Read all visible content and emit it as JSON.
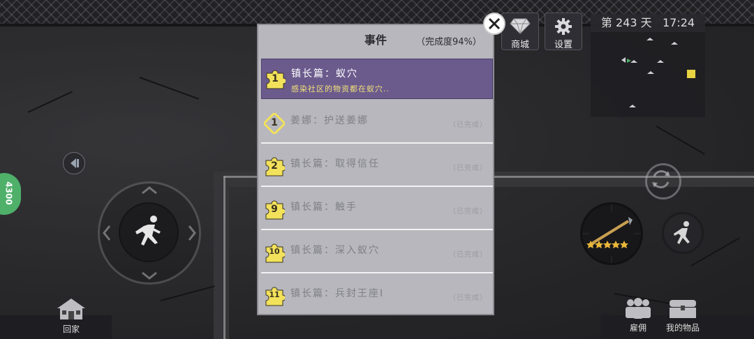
{
  "top": {
    "shop_label": "商城",
    "settings_label": "设置",
    "day_prefix": "第",
    "day_number": "243",
    "day_suffix": "天",
    "time": "17:24"
  },
  "left": {
    "home_label": "回家",
    "badge_text": "4300"
  },
  "bottom_right": {
    "hire_label": "雇佣",
    "items_label": "我的物品"
  },
  "dialog": {
    "title": "事件",
    "progress": "（完成度94%）",
    "items": [
      {
        "badge": "1",
        "badge_shape": "puzzle",
        "title": "镇长篇：蚁穴",
        "subtitle": "感染社区的物资都在蚁穴..",
        "status": "",
        "active": true
      },
      {
        "badge": "1",
        "badge_shape": "diamond",
        "title": "姜娜：护送姜娜",
        "subtitle": "",
        "status": "（已完成）",
        "active": false
      },
      {
        "badge": "2",
        "badge_shape": "puzzle",
        "title": "镇长篇：取得信任",
        "subtitle": "",
        "status": "（已完成）",
        "active": false
      },
      {
        "badge": "9",
        "badge_shape": "puzzle",
        "title": "镇长篇：触手",
        "subtitle": "",
        "status": "（已完成）",
        "active": false
      },
      {
        "badge": "10",
        "badge_shape": "puzzle",
        "title": "镇长篇：深入蚁穴",
        "subtitle": "",
        "status": "（已完成）",
        "active": false
      },
      {
        "badge": "11",
        "badge_shape": "puzzle",
        "title": "镇长篇：兵封王座I",
        "subtitle": "",
        "status": "（已完成）",
        "active": false
      }
    ]
  },
  "colors": {
    "active_row": "#6b5b8d",
    "badge_yellow": "#f2e15a",
    "subtitle_yellow": "#f1e07a",
    "dialog_bg": "#b7b7bd",
    "weapon_stars": "#e8b73a"
  },
  "weapon": {
    "stars": 5
  }
}
